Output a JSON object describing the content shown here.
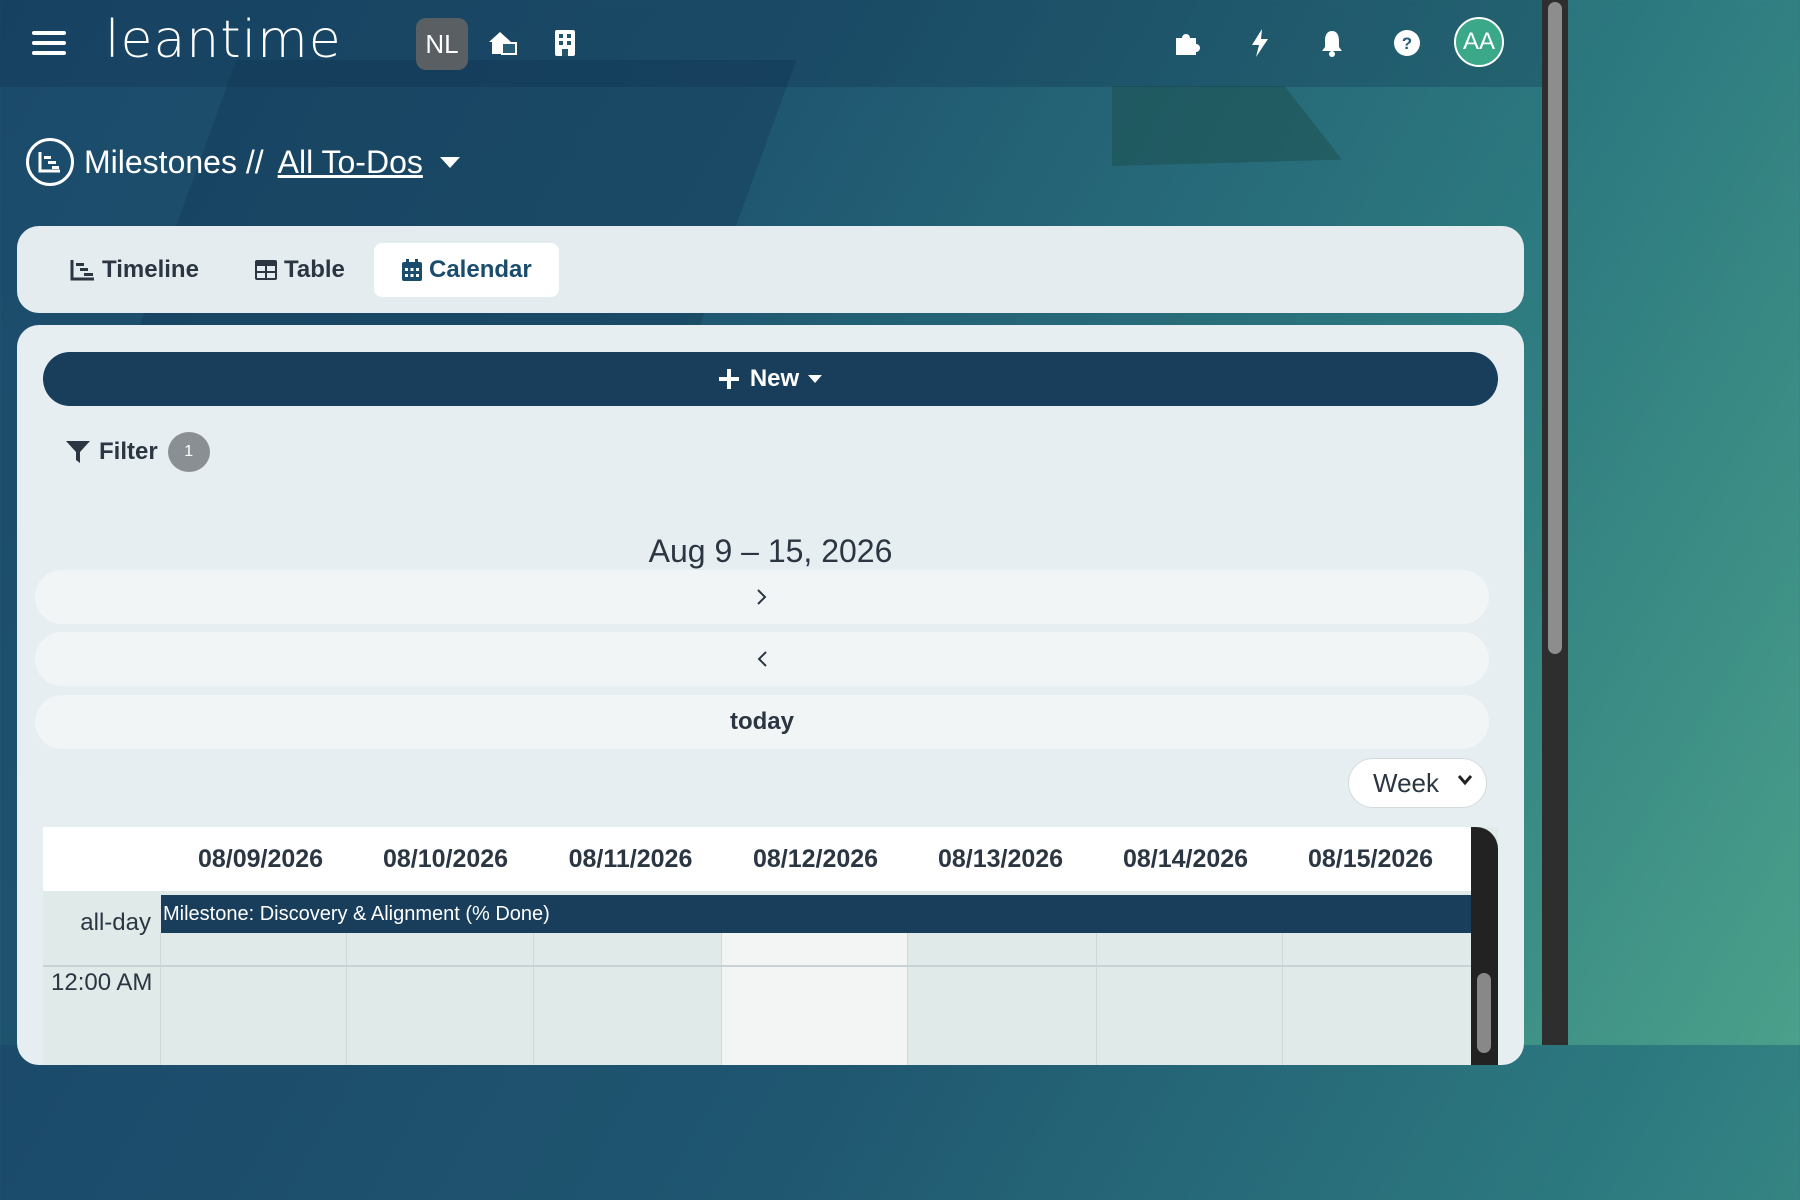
{
  "app": {
    "logo_text": "leantime"
  },
  "header": {
    "project_badge": "NL",
    "avatar_initials": "AA"
  },
  "page": {
    "section": "Milestones //",
    "view_link": "All To-Dos"
  },
  "tabs": [
    {
      "label": "Timeline",
      "icon": "timeline-icon"
    },
    {
      "label": "Table",
      "icon": "table-icon"
    },
    {
      "label": "Calendar",
      "icon": "calendar-icon",
      "active": true
    }
  ],
  "toolbar": {
    "new_label": "New",
    "filter_label": "Filter",
    "filter_count": "1"
  },
  "calendar": {
    "range_title": "Aug 9 – 15, 2026",
    "next_label": ">",
    "prev_label": "<",
    "today_label": "today",
    "view_select": "Week",
    "days": [
      "08/09/2026",
      "08/10/2026",
      "08/11/2026",
      "08/12/2026",
      "08/13/2026",
      "08/14/2026",
      "08/15/2026"
    ],
    "allday_label": "all-day",
    "time_label": "12:00 AM",
    "event_title": "Milestone: Discovery & Alignment (% Done)"
  },
  "colors": {
    "primary": "#183e5c",
    "accent": "#3aa889"
  }
}
